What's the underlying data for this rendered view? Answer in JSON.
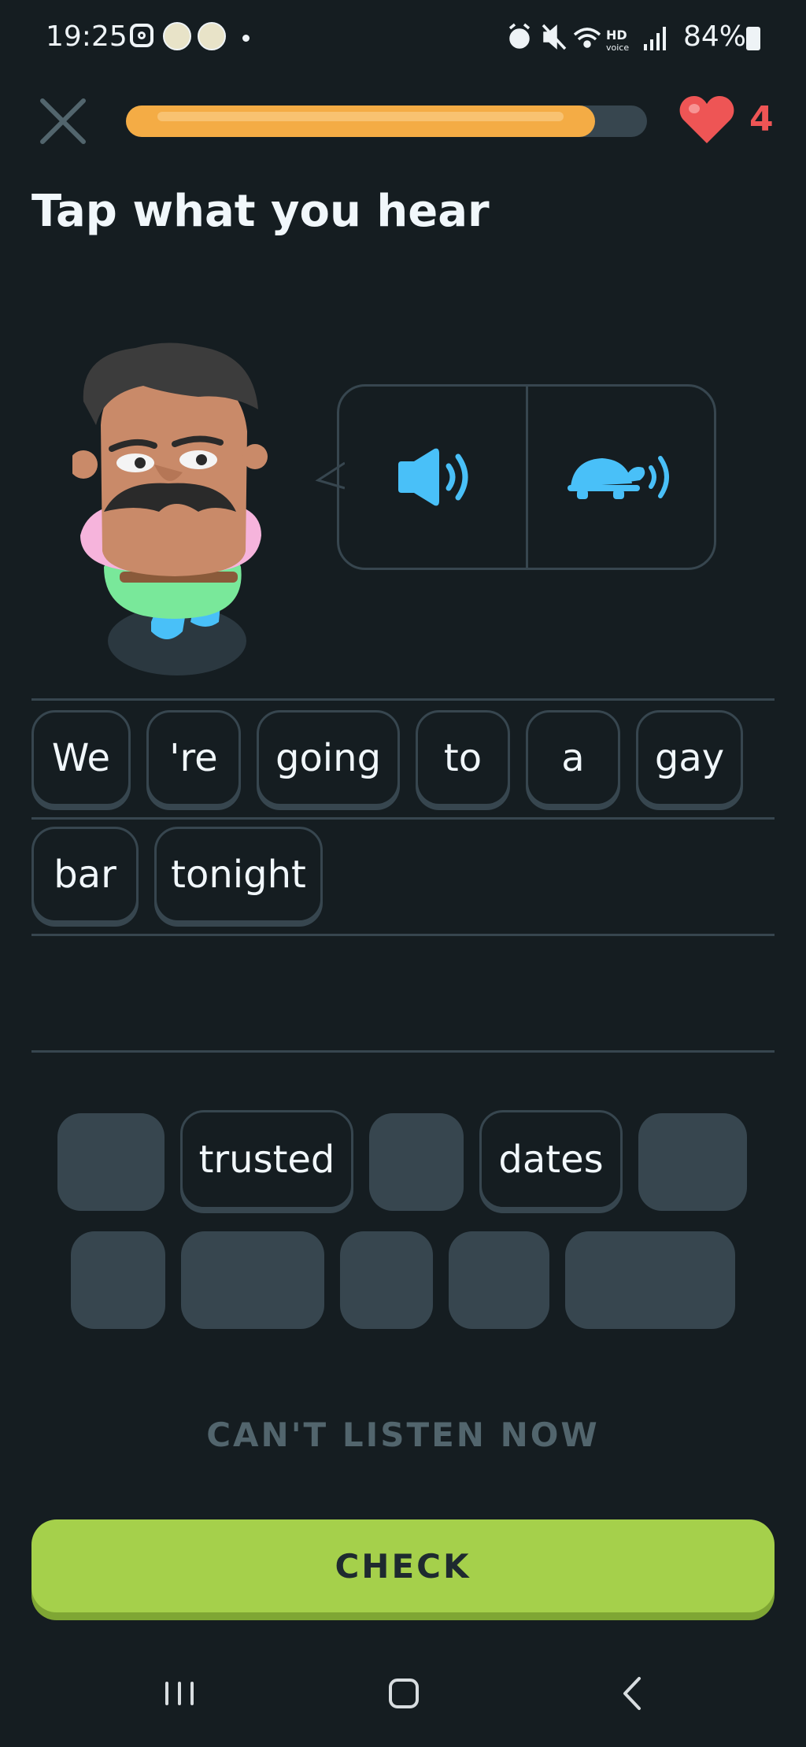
{
  "status_bar": {
    "time": "19:25",
    "battery": "84%",
    "icons": [
      "instagram-icon",
      "app-icon",
      "app-icon",
      "alarm-icon",
      "mute-icon",
      "wifi-icon",
      "hd-voice-icon",
      "signal-icon",
      "battery-icon"
    ]
  },
  "header": {
    "progress_percent": 0.9,
    "hearts": "4"
  },
  "lesson": {
    "title": "Tap what you hear"
  },
  "answer": {
    "words": [
      "We",
      "'re",
      "going",
      "to",
      "a",
      "gay",
      "bar",
      "tonight"
    ]
  },
  "word_bank": {
    "remaining": [
      "trusted",
      "dates"
    ]
  },
  "actions": {
    "cant_listen": "CAN'T LISTEN NOW",
    "check": "CHECK"
  },
  "colors": {
    "background": "#151d21",
    "border": "#37464f",
    "progress": "#f4ac45",
    "heart": "#ee5555",
    "check": "#a5d04b",
    "audio_blue": "#49c0f8"
  }
}
